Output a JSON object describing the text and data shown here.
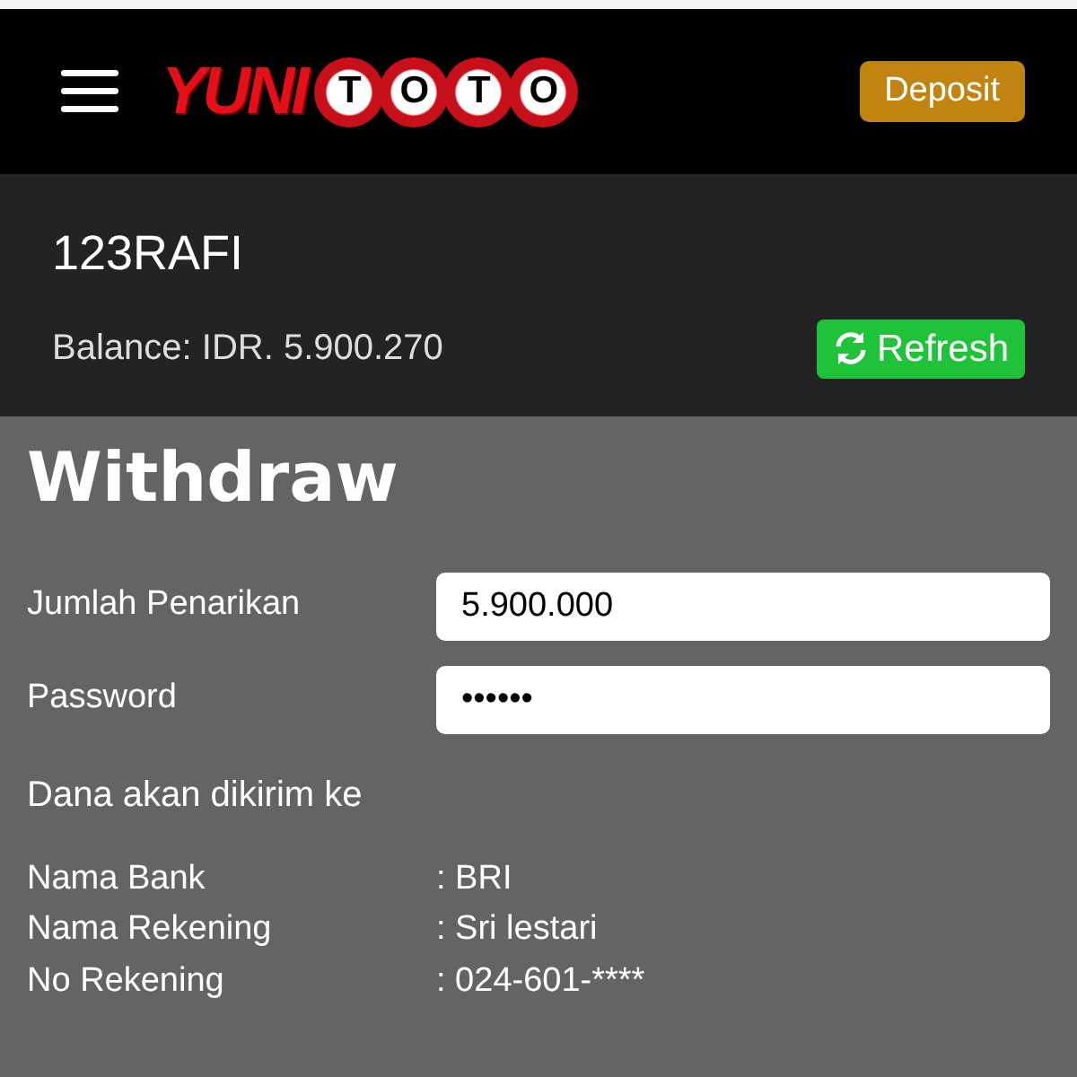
{
  "header": {
    "logo": {
      "prefix": "YUNI",
      "balls": [
        "T",
        "O",
        "T",
        "O"
      ]
    },
    "deposit_button": "Deposit"
  },
  "account": {
    "username": "123RAFI",
    "balance": "Balance: IDR. 5.900.270",
    "refresh_button": "Refresh"
  },
  "title": "Withdraw",
  "fields": [
    {
      "label": "Jumlah Penarikan",
      "value": "5.900.000"
    },
    {
      "label": "Password",
      "value": "••••••"
    }
  ],
  "destination_heading": "Dana akan dikirim ke",
  "details": [
    {
      "label": "Nama Bank",
      "value": ": BRI"
    },
    {
      "label": "Nama Rekening",
      "value": ": Sri lestari"
    },
    {
      "label": "No Rekening",
      "value": ": 024-601-****"
    }
  ]
}
